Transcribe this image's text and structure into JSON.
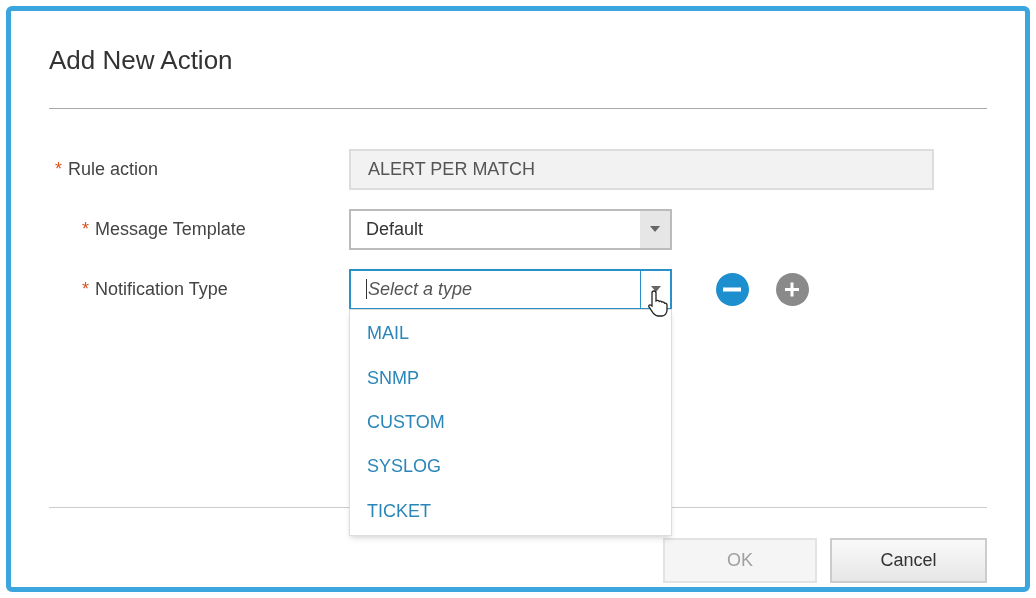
{
  "dialog": {
    "title": "Add New Action"
  },
  "fields": [
    {
      "kind": "text",
      "label": "Rule action",
      "marker": "*",
      "value": "ALERT PER MATCH",
      "disabled": true,
      "children": [
        {
          "kind": "select",
          "label": "Message Template",
          "marker": "*",
          "value": "Default",
          "focused": false
        },
        {
          "kind": "select",
          "label": "Notification Type",
          "marker": "*",
          "placeholder": "Select a type",
          "focused": true,
          "expanded": true,
          "options": [
            "MAIL",
            "SNMP",
            "CUSTOM",
            "SYSLOG",
            "TICKET"
          ],
          "row_buttons": [
            {
              "kind": "remove",
              "disabled": false
            },
            {
              "kind": "add",
              "disabled": true
            }
          ]
        }
      ]
    }
  ],
  "buttons": [
    {
      "label": "OK",
      "disabled": true
    },
    {
      "label": "Cancel",
      "disabled": false
    }
  ]
}
